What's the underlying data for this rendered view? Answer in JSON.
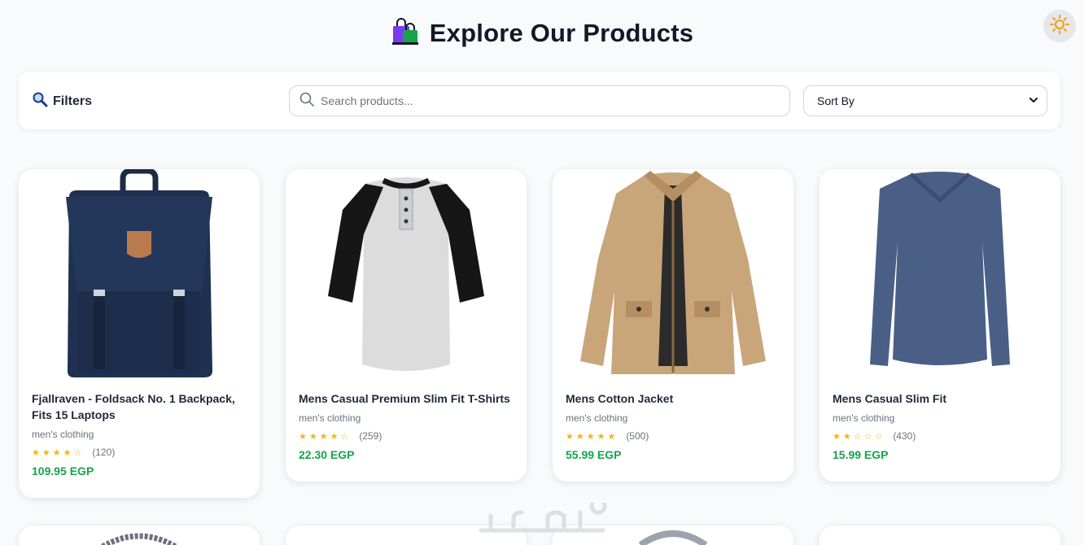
{
  "header": {
    "title": "Explore Our Products",
    "bag_icon": "shopping-bags-icon",
    "theme_icon": "sun-icon"
  },
  "toolbar": {
    "filters_label": "Filters",
    "filters_icon": "magnifier-icon",
    "search_placeholder": "Search products...",
    "search_value": "",
    "sort_label": "Sort By"
  },
  "products": [
    {
      "title": "Fjallraven - Foldsack No. 1 Backpack, Fits 15 Laptops",
      "category": "men's clothing",
      "rating": 3.9,
      "stars": "★★★★☆",
      "count": "(120)",
      "price": "109.95 EGP"
    },
    {
      "title": "Mens Casual Premium Slim Fit T-Shirts",
      "category": "men's clothing",
      "rating": 4.1,
      "stars": "★★★★☆",
      "count": "(259)",
      "price": "22.30 EGP"
    },
    {
      "title": "Mens Cotton Jacket",
      "category": "men's clothing",
      "rating": 4.7,
      "stars": "★★★★★",
      "count": "(500)",
      "price": "55.99 EGP"
    },
    {
      "title": "Mens Casual Slim Fit",
      "category": "men's clothing",
      "rating": 2.1,
      "stars": "★★☆☆☆",
      "count": "(430)",
      "price": "15.99 EGP"
    }
  ],
  "colors": {
    "accent": "#16a34a",
    "star": "#f5b50a",
    "background": "#f8fafc"
  },
  "watermark": "خمسات"
}
